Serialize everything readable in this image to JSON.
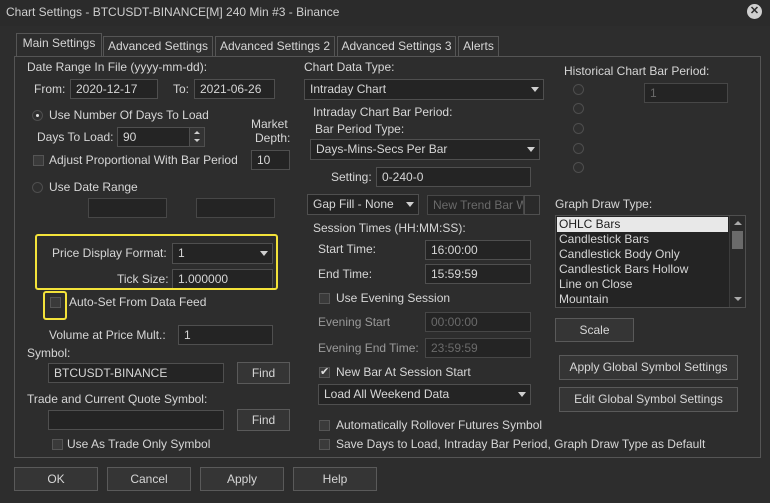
{
  "window": {
    "title": "Chart Settings - BTCUSDT-BINANCE[M]  240 Min   #3 - Binance"
  },
  "tabs": [
    {
      "label": "Main Settings"
    },
    {
      "label": "Advanced Settings"
    },
    {
      "label": "Advanced Settings 2"
    },
    {
      "label": "Advanced Settings 3"
    },
    {
      "label": "Alerts"
    }
  ],
  "left": {
    "date_range_label": "Date Range In File (yyyy-mm-dd):",
    "from_label": "From:",
    "from_value": "2020-12-17",
    "to_label": "To:",
    "to_value": "2021-06-26",
    "use_days_label": "Use Number Of Days To Load",
    "days_label": "Days To Load:",
    "days_value": "90",
    "market_depth_label_1": "Market",
    "market_depth_label_2": "Depth:",
    "market_depth_value": "10",
    "adjust_label": "Adjust Proportional With Bar Period",
    "use_date_range_label": "Use Date Range",
    "price_format_label": "Price Display Format:",
    "price_format_value": "1",
    "tick_size_label": "Tick Size:",
    "tick_size_value": "1.000000",
    "autoset_label": "Auto-Set From Data Feed",
    "vap_label": "Volume at Price Mult.:",
    "vap_value": "1",
    "symbol_label": "Symbol:",
    "symbol_value": "BTCUSDT-BINANCE",
    "find_label": "Find",
    "trade_symbol_label": "Trade and Current Quote Symbol:",
    "trade_symbol_value": "",
    "find2_label": "Find",
    "trade_only_label": "Use As Trade Only Symbol"
  },
  "middle": {
    "chart_type_label": "Chart Data Type:",
    "chart_type_value": "Intraday Chart",
    "intraday_period_label": "Intraday Chart Bar Period:",
    "bar_period_type_label": "Bar Period Type:",
    "bar_period_type_value": "Days-Mins-Secs Per Bar",
    "setting_label": "Setting:",
    "setting_value": "0-240-0",
    "gap_fill_value": "Gap Fill - None",
    "new_trend_placeholder": "New Trend Bar W",
    "session_label": "Session Times (HH:MM:SS):",
    "start_label": "Start Time:",
    "start_value": "16:00:00",
    "end_label": "End Time:",
    "end_value": "15:59:59",
    "evening_label": "Use Evening Session",
    "evening_start_label": "Evening Start",
    "evening_start_value": "00:00:00",
    "evening_end_label": "Evening End Time:",
    "evening_end_value": "23:59:59",
    "new_bar_label": "New Bar At Session Start",
    "weekend_value": "Load All Weekend Data",
    "rollover_label": "Automatically Rollover Futures Symbol",
    "save_days_label": "Save Days to Load, Intraday Bar Period, Graph Draw Type as Default"
  },
  "right": {
    "hist_period_label": "Historical Chart Bar Period:",
    "hist_value": "1",
    "graph_draw_label": "Graph Draw Type:",
    "draw_types": [
      "OHLC Bars",
      "Candlestick Bars",
      "Candlestick Body Only",
      "Candlestick Bars Hollow",
      "Line on Close",
      "Mountain"
    ],
    "scale_label": "Scale",
    "apply_global_label": "Apply Global Symbol Settings",
    "edit_global_label": "Edit Global Symbol Settings"
  },
  "footer": {
    "ok": "OK",
    "cancel": "Cancel",
    "apply": "Apply",
    "help": "Help"
  },
  "colors": {
    "background": "#2d2d2d",
    "highlight": "#f3e23a",
    "selection": "#e8e8e8"
  }
}
